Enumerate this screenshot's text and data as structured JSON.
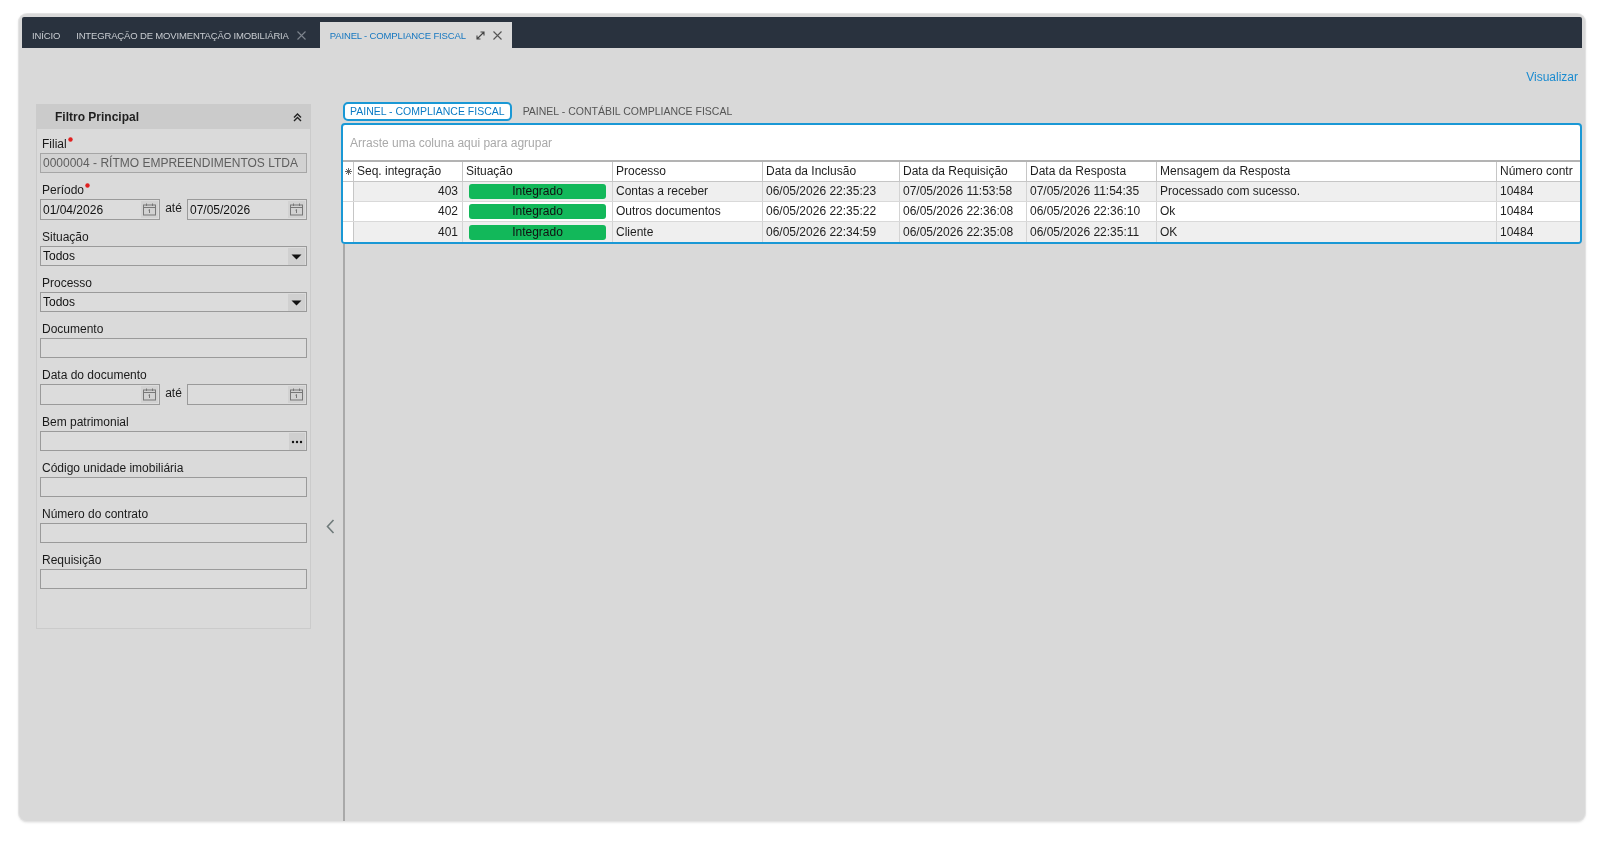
{
  "window": {
    "tabs": [
      {
        "label": "INÍCIO",
        "selected": false,
        "closable": false,
        "expandable": false
      },
      {
        "label": "INTEGRAÇÃO DE MOVIMENTAÇÃO IMOBILIÁRIA",
        "selected": false,
        "closable": true,
        "expandable": false
      },
      {
        "label": "PAINEL - COMPLIANCE FISCAL",
        "selected": true,
        "closable": true,
        "expandable": true
      }
    ]
  },
  "toolbar": {
    "link": "Visualizar"
  },
  "filter_panel": {
    "title": "Filtro Principal",
    "expanded": true,
    "fields": [
      {
        "kind": "text",
        "label": "Filial",
        "required": true,
        "disabled": true,
        "value": "0000004 - RÍTMO EMPREENDIMENTOS LTDA"
      },
      {
        "kind": "date_range",
        "label": "Período",
        "required": true,
        "disabled": false,
        "from": "01/04/2026",
        "separator": "até",
        "to": "07/05/2026"
      },
      {
        "kind": "select",
        "label": "Situação",
        "required": false,
        "disabled": false,
        "value": "Todos"
      },
      {
        "kind": "select",
        "label": "Processo",
        "required": false,
        "disabled": false,
        "value": "Todos"
      },
      {
        "kind": "text",
        "label": "Documento",
        "required": false,
        "disabled": false
      },
      {
        "kind": "date_range",
        "label": "Data do documento",
        "required": false,
        "disabled": false,
        "separator": "até"
      },
      {
        "kind": "lookup",
        "label": "Bem patrimonial",
        "required": false,
        "disabled": false
      },
      {
        "kind": "text",
        "label": "Código unidade imobiliária",
        "required": false,
        "disabled": false
      },
      {
        "kind": "text",
        "label": "Número do contrato",
        "required": false,
        "disabled": false
      },
      {
        "kind": "text",
        "label": "Requisição",
        "required": false,
        "disabled": false
      }
    ]
  },
  "content": {
    "tabs": [
      {
        "label": "PAINEL - COMPLIANCE FISCAL",
        "selected": true
      },
      {
        "label": "PAINEL - CONTÁBIL COMPLIANCE FISCAL",
        "selected": false
      }
    ],
    "grid": {
      "placeholder": "Arraste uma coluna aqui para agrupar",
      "columns": [
        {
          "label": "Seq. integração",
          "kind": "number"
        },
        {
          "label": "Situação",
          "kind": "status"
        },
        {
          "label": "Processo",
          "kind": "text"
        },
        {
          "label": "Data da Inclusão",
          "kind": "text"
        },
        {
          "label": "Data da Requisição",
          "kind": "text"
        },
        {
          "label": "Data da Resposta",
          "kind": "text"
        },
        {
          "label": "Mensagem da Resposta",
          "kind": "text"
        },
        {
          "label": "Número contr",
          "kind": "text"
        }
      ],
      "rows": [
        {
          "cells": [
            "403",
            "Integrado",
            "Contas a receber",
            "06/05/2026 22:35:23",
            "07/05/2026 11:53:58",
            "07/05/2026 11:54:35",
            "Processado com sucesso.",
            "10484"
          ]
        },
        {
          "cells": [
            "402",
            "Integrado",
            "Outros documentos",
            "06/05/2026 22:35:22",
            "06/05/2026 22:36:08",
            "06/05/2026 22:36:10",
            "Ok",
            "10484"
          ]
        },
        {
          "cells": [
            "401",
            "Integrado",
            "Cliente",
            "06/05/2026 22:34:59",
            "06/05/2026 22:35:08",
            "06/05/2026 22:35:11",
            "OK",
            "10484"
          ]
        }
      ]
    }
  }
}
